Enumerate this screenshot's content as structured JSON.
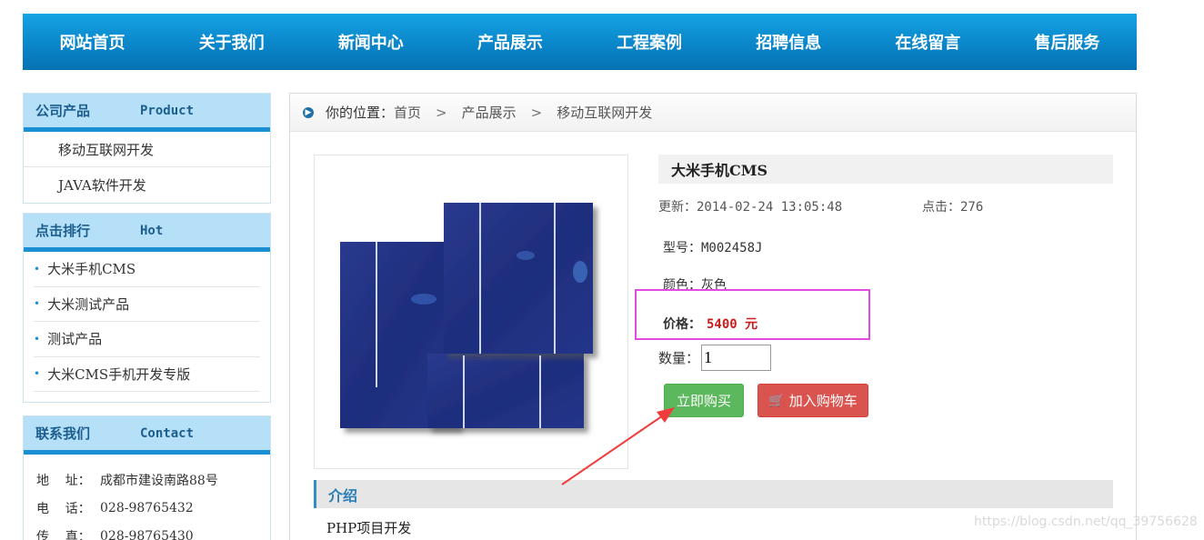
{
  "nav": {
    "items": [
      "网站首页",
      "关于我们",
      "新闻中心",
      "产品展示",
      "工程案例",
      "招聘信息",
      "在线留言",
      "售后服务"
    ]
  },
  "sidebar": {
    "products": {
      "title_cn": "公司产品",
      "title_en": "Product",
      "items": [
        "移动互联网开发",
        "JAVA软件开发"
      ]
    },
    "hot": {
      "title_cn": "点击排行",
      "title_en": "Hot",
      "items": [
        "大米手机CMS",
        "大米测试产品",
        "测试产品",
        "大米CMS手机开发专版"
      ]
    },
    "contact": {
      "title_cn": "联系我们",
      "title_en": "Contact",
      "rows": [
        {
          "label": "地    址：",
          "value": "成都市建设南路88号"
        },
        {
          "label": "电    话：",
          "value": "028-98765432"
        },
        {
          "label": "传    真：",
          "value": "028-98765430"
        }
      ]
    }
  },
  "breadcrumb": {
    "prefix": "你的位置：",
    "items": [
      "首页",
      "产品展示",
      "移动互联网开发"
    ],
    "separator": ">"
  },
  "product": {
    "title": "大米手机CMS",
    "updated_label": "更新：",
    "updated": "2014-02-24 13:05:48",
    "hits_label": "点击：",
    "hits": "276",
    "model_label": "型号：",
    "model": "M002458J",
    "color_label": "颜色：",
    "color": "灰色",
    "price_label": "价格：",
    "price": "5400 元",
    "qty_label": "数量：",
    "qty_value": "1",
    "buy_label": "立即购买",
    "cart_label": "加入购物车",
    "intro_title": "介绍",
    "intro_text": "PHP项目开发"
  },
  "watermark": "https://blog.csdn.net/qq_39756628",
  "colors": {
    "nav_bg": "#0a86c9",
    "accent": "#1a8fd3",
    "price": "#cc1c1c",
    "buy": "#5cb85c",
    "cart": "#d9534f",
    "highlight": "#e24be0",
    "arrow": "#f03c3c"
  }
}
